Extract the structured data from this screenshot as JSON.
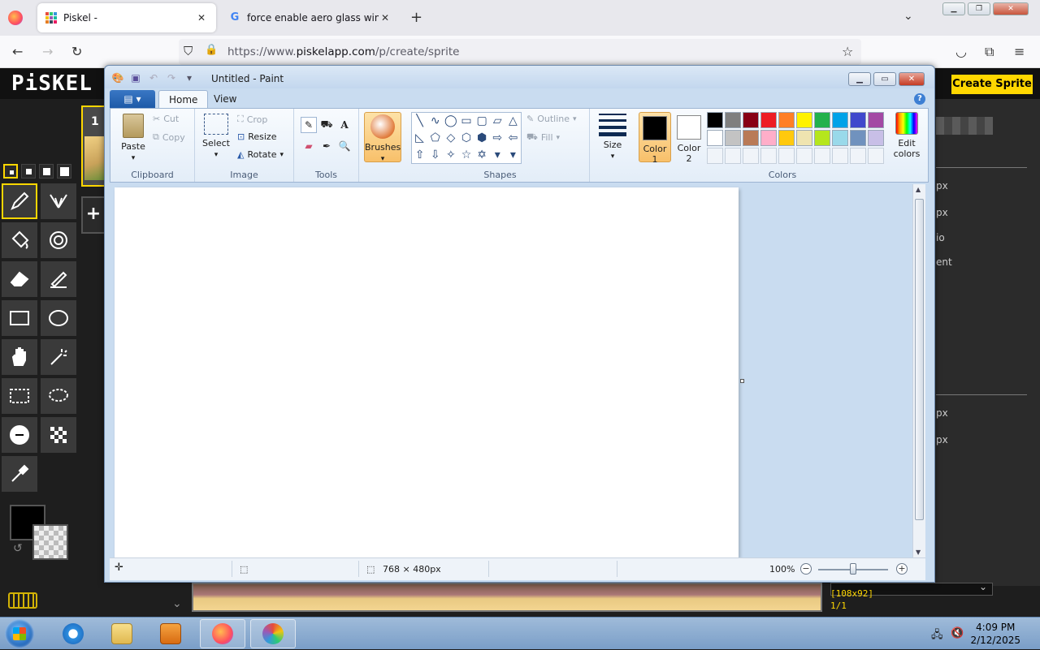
{
  "browser": {
    "tabs": [
      {
        "title": "Piskel -",
        "active": true
      },
      {
        "title": "force enable aero glass window",
        "active": false
      }
    ],
    "url_prefix": "https://www.",
    "url_domain": "piskelapp.com",
    "url_path": "/p/create/sprite",
    "icons": {
      "back": "←",
      "forward": "→",
      "reload": "↻",
      "shield": "⛉",
      "lock": "🔒",
      "star": "☆",
      "pocket": "◡",
      "extensions": "⧉",
      "menu": "≡",
      "new_tab": "+",
      "tab_list": "⌄",
      "close_tab": "✕"
    }
  },
  "piskel": {
    "logo": "PiSKEL",
    "create_button": "Create Sprite",
    "frame_number": "1",
    "add_frame": "+",
    "right_labels": [
      "px",
      "px",
      "io",
      "ent",
      "px",
      "px"
    ],
    "size_info": "[108x92]",
    "frame_info": "1/1",
    "primary_color": "#000000",
    "accent": "#ffd700"
  },
  "paint": {
    "title": "Untitled - Paint",
    "file_menu_icon": "▤ ▾",
    "tabs": {
      "home": "Home",
      "view": "View"
    },
    "help": "?",
    "clipboard": {
      "paste": "Paste",
      "cut": "Cut",
      "copy": "Copy",
      "group": "Clipboard"
    },
    "image": {
      "select": "Select",
      "crop": "Crop",
      "resize": "Resize",
      "rotate": "Rotate",
      "group": "Image"
    },
    "tools": {
      "group": "Tools",
      "text_tool": "A"
    },
    "brushes": {
      "label": "Brushes"
    },
    "shapes": {
      "outline": "Outline",
      "fill": "Fill",
      "group": "Shapes",
      "glyphs": [
        "╲",
        "∿",
        "◯",
        "▭",
        "▢",
        "▱",
        "△",
        "◺",
        "⬠",
        "◇",
        "⬡",
        "⬢",
        "⇨",
        "⇦",
        "⇧",
        "⇩",
        "✧",
        "☆",
        "✡",
        "▾",
        "▾"
      ]
    },
    "size": {
      "label": "Size"
    },
    "colors": {
      "color1_label": "Color 1",
      "color1_line1": "Color",
      "color1_line2": "1",
      "color2_line1": "Color",
      "color2_line2": "2",
      "color1_value": "#000000",
      "color2_value": "#ffffff",
      "edit_line1": "Edit",
      "edit_line2": "colors",
      "group": "Colors",
      "palette_row1": [
        "#000000",
        "#7f7f7f",
        "#880015",
        "#ed1c24",
        "#ff7f27",
        "#fff200",
        "#22b14c",
        "#00a2e8",
        "#3f48cc",
        "#a349a4"
      ],
      "palette_row2": [
        "#ffffff",
        "#c3c3c3",
        "#b97a57",
        "#ffaec9",
        "#ffc90e",
        "#efe4b0",
        "#b5e61d",
        "#99d9ea",
        "#7092be",
        "#c8bfe7"
      ]
    },
    "status": {
      "dimensions": "768 × 480px",
      "zoom": "100%"
    }
  },
  "taskbar": {
    "time": "4:09 PM",
    "date": "2/12/2025"
  }
}
